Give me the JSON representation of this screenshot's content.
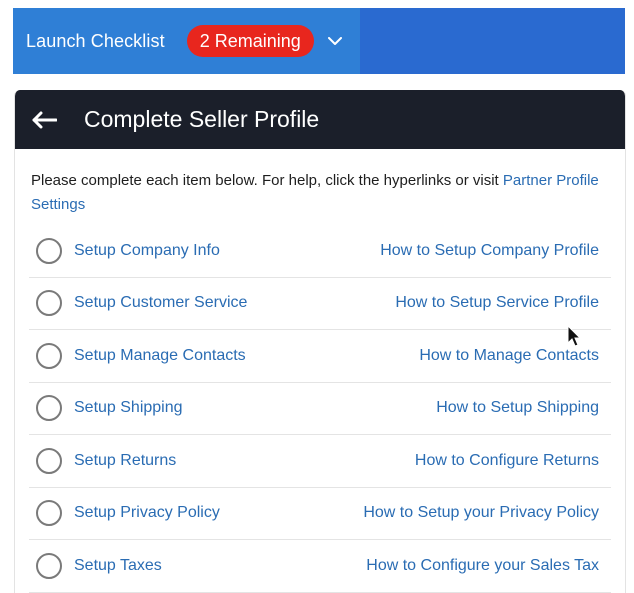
{
  "launch_bar": {
    "title": "Launch Checklist",
    "badge": "2 Remaining",
    "colors": {
      "bar": "#2f7fd6",
      "badge": "#e8261e"
    }
  },
  "panel": {
    "title": "Complete Seller Profile",
    "intro_text": "Please complete each item below. For help, click the hyperlinks or visit ",
    "intro_link": "Partner Profile Settings"
  },
  "tasks": [
    {
      "label": "Setup Company Info",
      "help": "How to Setup Company Profile"
    },
    {
      "label": "Setup Customer Service",
      "help": "How to Setup Service Profile"
    },
    {
      "label": "Setup Manage Contacts",
      "help": "How to Manage Contacts"
    },
    {
      "label": "Setup Shipping",
      "help": "How to Setup Shipping"
    },
    {
      "label": "Setup Returns",
      "help": "How to Configure Returns"
    },
    {
      "label": "Setup Privacy Policy",
      "help": "How to Setup your Privacy Policy"
    },
    {
      "label": "Setup Taxes",
      "help": "How to Configure your Sales Tax"
    }
  ]
}
